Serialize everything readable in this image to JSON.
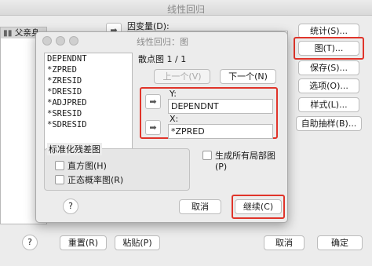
{
  "main_window": {
    "title": "线性回归",
    "dependent_label": "因变量(D):",
    "source_item": "父亲身",
    "buttons": {
      "statistics": "统计(S)...",
      "plots": "图(T)...",
      "save": "保存(S)...",
      "options": "选项(O)...",
      "style": "样式(L)...",
      "bootstrap": "自助抽样(B)...",
      "help": "?",
      "reset": "重置(R)",
      "paste": "粘贴(P)",
      "cancel": "取消",
      "ok": "确定"
    }
  },
  "dialog": {
    "title": "线性回归：图",
    "variables": [
      "DEPENDNT",
      "*ZPRED",
      "*ZRESID",
      "*DRESID",
      "*ADJPRED",
      "*SRESID",
      "*SDRESID"
    ],
    "scatter_header": "散点图 1 / 1",
    "prev_button": "上一个(V)",
    "next_button": "下一个(N)",
    "y_label": "Y:",
    "y_value": "DEPENDNT",
    "x_label": "X:",
    "x_value": "*ZPRED",
    "std_resid_title": "标准化残差图",
    "histogram": "直方图(H)",
    "normal_prob": "正态概率图(R)",
    "partial_plots": "生成所有局部图(P)",
    "help": "?",
    "cancel": "取消",
    "continue": "继续(C)"
  },
  "icons": {
    "arrow": "right-arrow-icon",
    "help": "question-icon"
  },
  "colors": {
    "highlight": "#e0342a"
  }
}
